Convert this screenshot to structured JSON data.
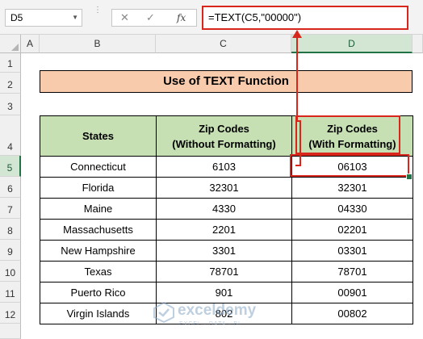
{
  "formula_bar": {
    "name_box": "D5",
    "cancel_icon": "✕",
    "enter_icon": "✓",
    "fx_label": "fx",
    "formula": "=TEXT(C5,\"00000\")"
  },
  "columns": [
    "A",
    "B",
    "C",
    "D"
  ],
  "rows": [
    "1",
    "2",
    "3",
    "4",
    "5",
    "6",
    "7",
    "8",
    "9",
    "10",
    "11",
    "12"
  ],
  "title": "Use of TEXT Function",
  "table": {
    "headers": [
      [
        "States"
      ],
      [
        "Zip Codes",
        "(Without Formatting)"
      ],
      [
        "Zip Codes",
        "(With Formatting)"
      ]
    ],
    "rows": [
      [
        "Connecticut",
        "6103",
        "06103"
      ],
      [
        "Florida",
        "32301",
        "32301"
      ],
      [
        "Maine",
        "4330",
        "04330"
      ],
      [
        "Massachusetts",
        "2201",
        "02201"
      ],
      [
        "New Hampshire",
        "3301",
        "03301"
      ],
      [
        "Texas",
        "78701",
        "78701"
      ],
      [
        "Puerto Rico",
        "901",
        "00901"
      ],
      [
        "Virgin Islands",
        "802",
        "00802"
      ]
    ]
  },
  "selection": {
    "active_cell": "D5",
    "active_row": "5",
    "active_column": "D"
  },
  "colors": {
    "accent_red": "#d9261c",
    "title_fill": "#f8cbad",
    "header_fill": "#c6e0b4",
    "excel_green": "#217346"
  },
  "watermark": {
    "name": "exceldemy",
    "tag": "EXCEL · DATA · BI"
  }
}
